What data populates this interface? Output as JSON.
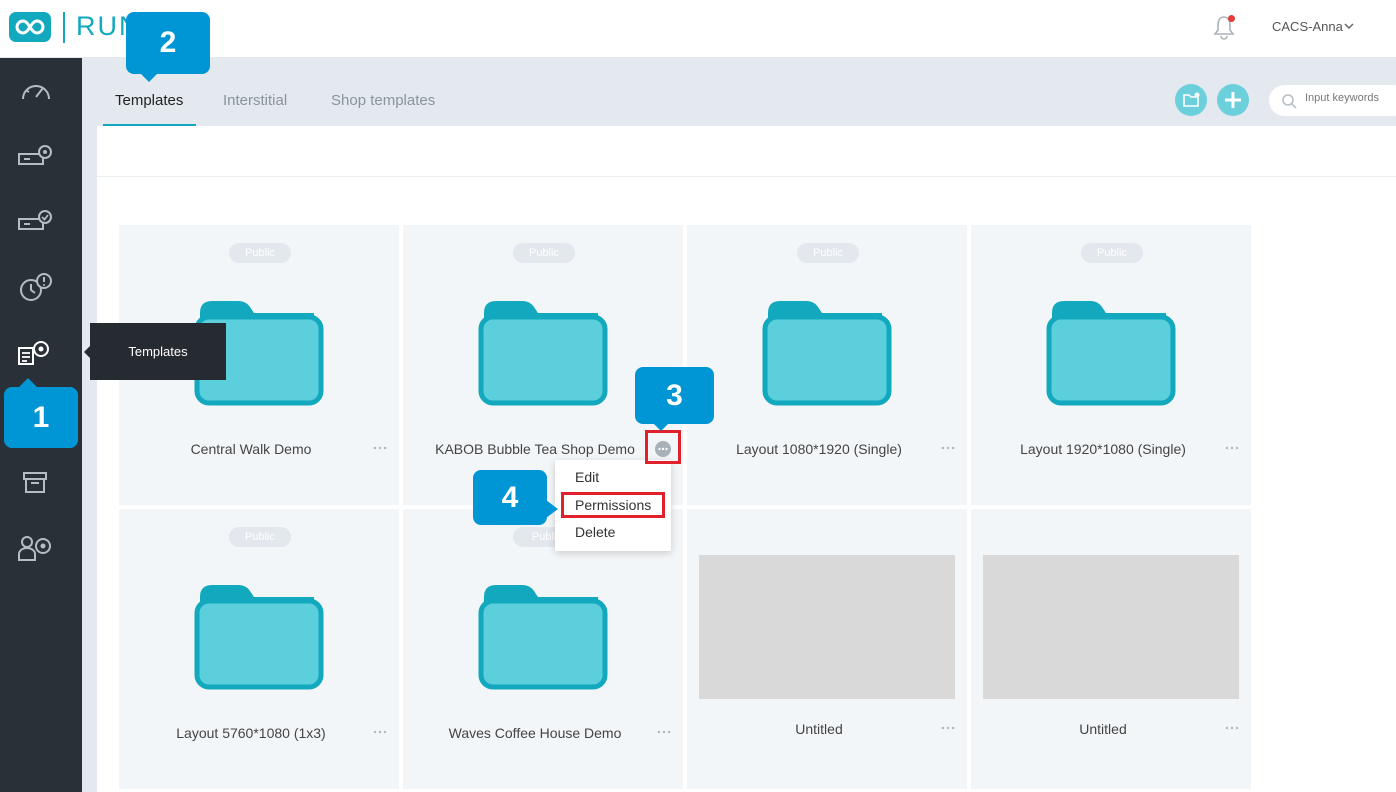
{
  "header": {
    "logo_text": "RUN",
    "user_name": "CACS-Anna"
  },
  "sidebar": {
    "items": [
      {
        "icon": "dashboard-icon"
      },
      {
        "icon": "device-settings-icon"
      },
      {
        "icon": "device-check-icon"
      },
      {
        "icon": "alert-clock-icon"
      },
      {
        "icon": "templates-icon"
      },
      {
        "icon": "archive-icon"
      },
      {
        "icon": "user-settings-icon"
      }
    ],
    "tooltip": "Templates"
  },
  "tabs": [
    {
      "label": "Templates",
      "active": true
    },
    {
      "label": "Interstitial",
      "active": false
    },
    {
      "label": "Shop templates",
      "active": false
    }
  ],
  "search": {
    "placeholder": "Input keywords"
  },
  "cards": [
    {
      "title": "Central Walk Demo",
      "badge": "Public",
      "type": "folder"
    },
    {
      "title": "KABOB Bubble Tea Shop Demo",
      "badge": "Public",
      "type": "folder"
    },
    {
      "title": "Layout 1080*1920 (Single)",
      "badge": "Public",
      "type": "folder"
    },
    {
      "title": "Layout 1920*1080 (Single)",
      "badge": "Public",
      "type": "folder"
    },
    {
      "title": "Layout 5760*1080 (1x3)",
      "badge": "Public",
      "type": "folder"
    },
    {
      "title": "Waves Coffee House Demo",
      "badge": "Publi",
      "type": "folder"
    },
    {
      "title": "Untitled",
      "badge": "",
      "type": "image"
    },
    {
      "title": "Untitled",
      "badge": "",
      "type": "image"
    }
  ],
  "menu": {
    "items": [
      "Edit",
      "Permissions",
      "Delete"
    ]
  },
  "callouts": [
    "1",
    "2",
    "3",
    "4"
  ],
  "colors": {
    "accent": "#12a8bd",
    "sidebar": "#293038",
    "callout": "#0096d6",
    "highlight": "#e0212b"
  }
}
